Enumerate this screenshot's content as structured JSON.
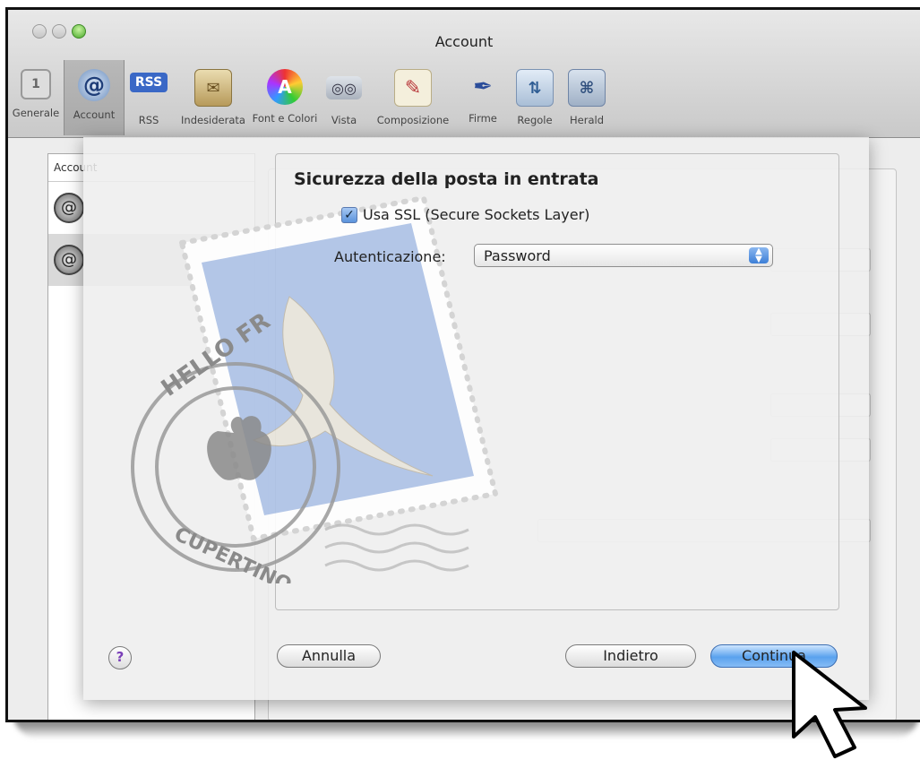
{
  "window": {
    "title": "Account"
  },
  "toolbar": {
    "items": [
      {
        "label": "Generale",
        "icon": "general-switch-icon"
      },
      {
        "label": "Account",
        "icon": "at-sign-icon",
        "selected": true
      },
      {
        "label": "RSS",
        "icon": "rss-icon"
      },
      {
        "label": "Indesiderata",
        "icon": "junk-mail-icon"
      },
      {
        "label": "Font e Colori",
        "icon": "fonts-colors-icon"
      },
      {
        "label": "Vista",
        "icon": "glasses-icon"
      },
      {
        "label": "Composizione",
        "icon": "compose-pencil-icon"
      },
      {
        "label": "Firme",
        "icon": "signature-pen-icon"
      },
      {
        "label": "Regole",
        "icon": "rules-icon"
      },
      {
        "label": "Herald",
        "icon": "herald-icon"
      }
    ]
  },
  "sidebar": {
    "header": "Account"
  },
  "sheet": {
    "title": "Sicurezza della posta in entrata",
    "ssl_label": "Usa SSL (Secure Sockets Layer)",
    "ssl_checked": true,
    "auth_label": "Autenticazione:",
    "auth_value": "Password",
    "stamp_text_top": "HELLO FR",
    "stamp_text_bottom": "CUPERTINO CA",
    "buttons": {
      "help": "?",
      "cancel": "Annulla",
      "back": "Indietro",
      "continue": "Continua"
    }
  },
  "colors": {
    "primary_button": "#5aa2ee",
    "checkbox": "#5b93dc"
  }
}
